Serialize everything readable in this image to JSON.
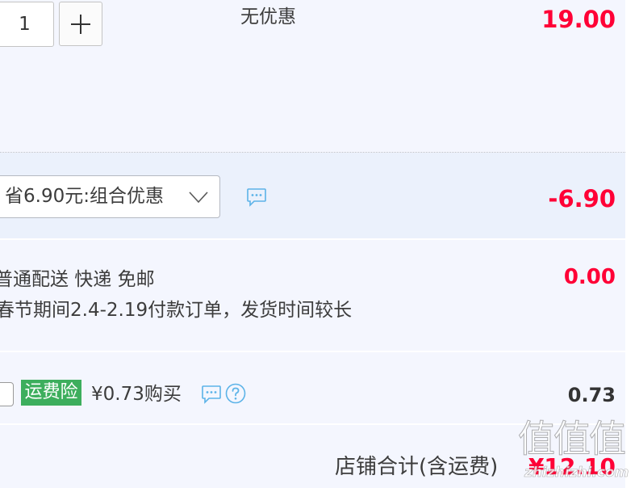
{
  "item": {
    "quantity": "1",
    "promotion": "无优惠",
    "price": "19.00"
  },
  "discount": {
    "selected_option": "省6.90元:组合优惠",
    "amount": "-6.90"
  },
  "shipping": {
    "method": "普通配送 快递 免邮",
    "notice": "春节期间2.4-2.19付款订单，发货时间较长",
    "fee": "0.00"
  },
  "insurance": {
    "checked": false,
    "badge": "运费险",
    "offer": "¥0.73购买",
    "fee": "0.73"
  },
  "summary": {
    "label": "店铺合计(含运费)",
    "total": "¥12.10"
  },
  "watermark": {
    "glyphs": "值值值",
    "site": "zhizhizhi.com"
  },
  "icons": {
    "increment": "plus-icon",
    "dropdown": "chevron-down-icon",
    "message": "chat-icon",
    "help": "help-icon"
  },
  "colors": {
    "price_red": "#ff0036",
    "badge_green": "#3dae5d",
    "icon_blue": "#5cb3e8",
    "text_dark": "#3c3c3c",
    "panel_bg": "#f4f6fe",
    "discount_bg": "#ebf1fc"
  }
}
